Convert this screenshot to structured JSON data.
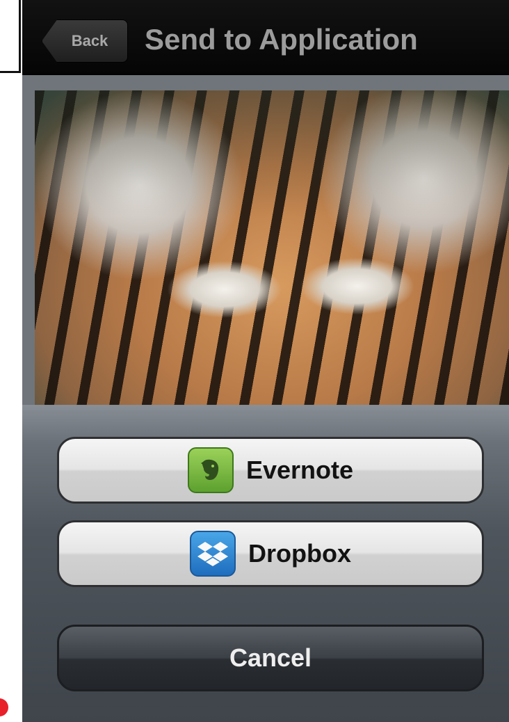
{
  "nav": {
    "back_label": "Back",
    "title": "Send to Application"
  },
  "photo": {
    "icon": "tiger-photo"
  },
  "actions": {
    "evernote_label": "Evernote",
    "dropbox_label": "Dropbox",
    "cancel_label": "Cancel",
    "evernote_icon": "evernote-elephant-icon",
    "dropbox_icon": "dropbox-box-icon"
  },
  "colors": {
    "navbar": "#0a0a0a",
    "title_text": "#9c9c9c",
    "evernote_green": "#5fa42f",
    "dropbox_blue": "#1e6fc2",
    "left_dot_red": "#e8202a"
  }
}
